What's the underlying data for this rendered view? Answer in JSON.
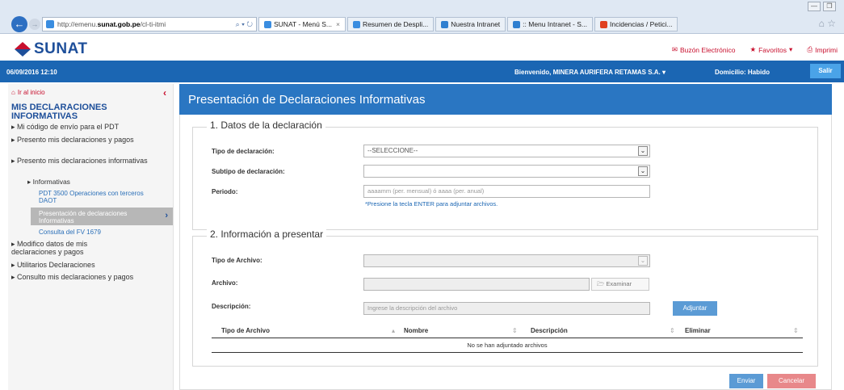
{
  "browser": {
    "url_prefix": "http://emenu.",
    "url_domain": "sunat.gob.pe",
    "url_suffix": "/cl-ti-itmi",
    "addr_tools": "⌕ ▾ ↻",
    "tabs": [
      {
        "label": "SUNAT - Menú S...",
        "color": "#3a8de0",
        "active": true
      },
      {
        "label": "Resumen de Despli...",
        "color": "#3a8de0",
        "active": false
      },
      {
        "label": "Nuestra Intranet",
        "color": "#2f7fd0",
        "active": false
      },
      {
        "label": ":: Menu Intranet - S...",
        "color": "#2f7fd0",
        "active": false
      },
      {
        "label": "Incidencias / Petici...",
        "color": "#e04020",
        "active": false
      }
    ]
  },
  "header": {
    "logo_text": "SUNAT",
    "links": {
      "buzon": "Buzón Electrónico",
      "favoritos": "Favoritos",
      "imprimir": "Imprimi"
    }
  },
  "bar": {
    "datetime": "06/09/2016 12:10",
    "welcome": "Bienvenido, MINERA AURIFERA RETAMAS S.A.",
    "domicilio": "Domicilio: Habido",
    "salir": "Salir"
  },
  "sidebar": {
    "home": "Ir al inicio",
    "title": "MIS DECLARACIONES INFORMATIVAS",
    "items": [
      "Mi código de envío para el PDT",
      "Presento mis declaraciones y pagos",
      "Presento mis declaraciones informativas",
      "Modifico datos de mis declaraciones y pagos",
      "Utilitarios Declaraciones",
      "Consulto mis declaraciones y pagos"
    ],
    "sub": "Informativas",
    "subsub": [
      "PDT 3500 Operaciones con terceros DAOT",
      "Presentación de declaraciones Informativas",
      "Consulta del FV 1679"
    ]
  },
  "main": {
    "title": "Presentación de Declaraciones Informativas",
    "section1": {
      "legend": "1. Datos de la declaración",
      "tipo_label": "Tipo de declaración:",
      "tipo_value": "--SELECCIONE--",
      "subtipo_label": "Subtipo de declaración:",
      "subtipo_value": "",
      "periodo_label": "Periodo:",
      "periodo_placeholder": "aaaamm (per. mensual) ó aaaa (per. anual)",
      "hint": "*Presione la tecla ENTER para adjuntar archivos."
    },
    "section2": {
      "legend": "2. Información a presentar",
      "tipo_archivo_label": "Tipo de Archivo:",
      "archivo_label": "Archivo:",
      "examinar": "Examinar",
      "descripcion_label": "Descripción:",
      "descripcion_placeholder": "Ingrese la descripción del archivo",
      "adjuntar": "Adjuntar"
    },
    "table": {
      "headers": [
        "Tipo de Archivo",
        "Nombre",
        "Descripción",
        "Eliminar"
      ],
      "empty": "No se han adjuntado archivos"
    },
    "enviar": "Enviar",
    "cancelar": "Cancelar"
  }
}
